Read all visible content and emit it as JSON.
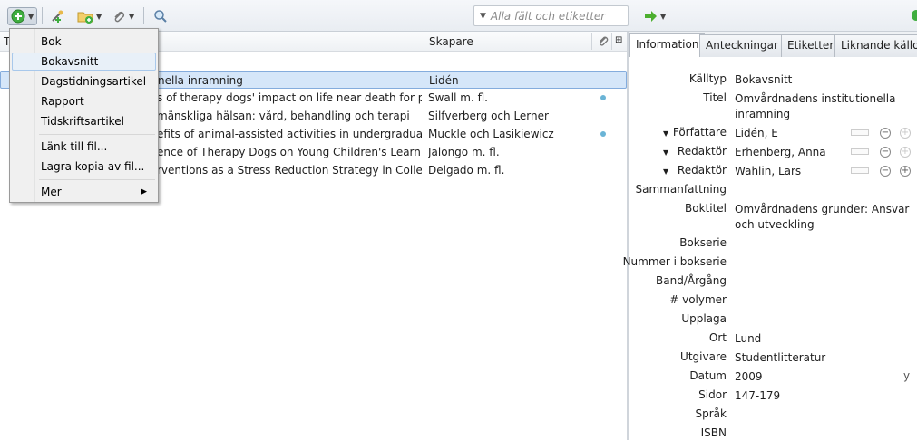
{
  "toolbar": {
    "search_placeholder": "Alla fält och etiketter"
  },
  "columns": {
    "title_header_initial": "T",
    "creator_header": "Skapare"
  },
  "items": [
    {
      "title": "nella inramning",
      "creator": "Lidén",
      "selected": true,
      "has_attachment": false
    },
    {
      "title": "s of therapy dogs' impact on life near death for person...",
      "creator": "Swall m. fl.",
      "selected": false,
      "has_attachment": true
    },
    {
      "title": "mänskliga hälsan: vård, behandling och terapi",
      "creator": "Silfverberg och Lerner",
      "selected": false,
      "has_attachment": false
    },
    {
      "title": "efits of animal-assisted activities in undergraduate stu...",
      "creator": "Muckle och Lasikiewicz",
      "selected": false,
      "has_attachment": true
    },
    {
      "title": "ence of Therapy Dogs on Young Children's Learning a...",
      "creator": "Jalongo m. fl.",
      "selected": false,
      "has_attachment": false
    },
    {
      "title": "rventions as a Stress Reduction Strategy in College Stu...",
      "creator": "Delgado m. fl.",
      "selected": false,
      "has_attachment": false
    }
  ],
  "new_item_menu": {
    "items": [
      "Bok",
      "Bokavsnitt",
      "Dagstidningsartikel",
      "Rapport",
      "Tidskriftsartikel"
    ],
    "highlighted": "Bokavsnitt",
    "file_items": [
      "Länk till fil...",
      "Lagra kopia av fil..."
    ],
    "more": "Mer"
  },
  "tabs": [
    "Information",
    "Anteckningar",
    "Etiketter",
    "Liknande källor"
  ],
  "active_tab": "Information",
  "info": {
    "item_type": {
      "label": "Källtyp",
      "value": "Bokavsnitt"
    },
    "title": {
      "label": "Titel",
      "value": "Omvårdnadens institutionella inramning"
    },
    "creators": [
      {
        "role": "Författare",
        "name": "Lidén, E"
      },
      {
        "role": "Redaktör",
        "name": "Erhenberg, Anna"
      },
      {
        "role": "Redaktör",
        "name": "Wahlin, Lars"
      }
    ],
    "abstract_label": "Sammanfattning",
    "book_title": {
      "label": "Boktitel",
      "value": "Omvårdnadens grunder: Ansvar och utveckling"
    },
    "series_label": "Bokserie",
    "series_number_label": "Nummer i bokserie",
    "volume_label": "Band/Årgång",
    "num_volumes_label": "# volymer",
    "edition_label": "Upplaga",
    "place": {
      "label": "Ort",
      "value": "Lund"
    },
    "publisher": {
      "label": "Utgivare",
      "value": "Studentlitteratur"
    },
    "date": {
      "label": "Datum",
      "value": "2009",
      "ymd": "y"
    },
    "pages": {
      "label": "Sidor",
      "value": "147-179"
    },
    "language_label": "Språk",
    "isbn_label": "ISBN"
  },
  "icons": [
    "new-item-icon",
    "new-item-from-id-icon",
    "new-collection-icon",
    "attachment-icon",
    "locate-icon",
    "sync-arrow-icon"
  ]
}
